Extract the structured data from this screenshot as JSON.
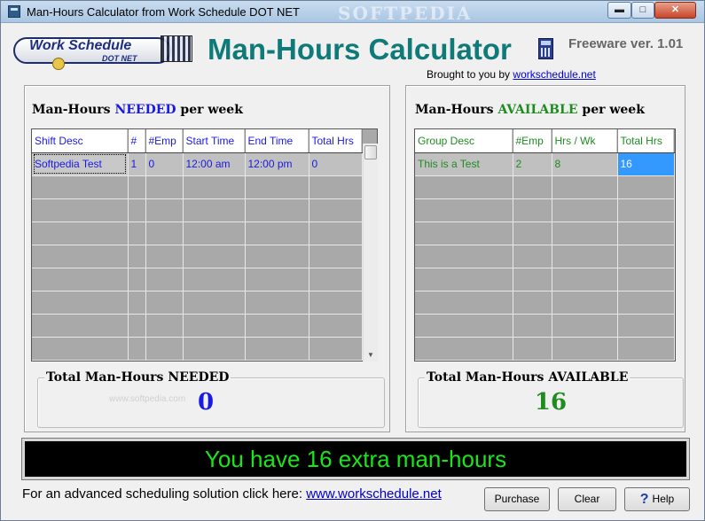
{
  "window": {
    "title": "Man-Hours Calculator from Work Schedule DOT NET",
    "watermark": "SOFTPEDIA"
  },
  "header": {
    "logo_text": "Work Schedule",
    "logo_sub": "DOT NET",
    "app_title": "Man-Hours Calculator",
    "brought_prefix": "Brought to you by",
    "brought_link": "workschedule.net",
    "version": "Freeware ver. 1.01"
  },
  "needed": {
    "heading_pre": "Man-Hours",
    "heading_hl": "NEEDED",
    "heading_post": "per week",
    "columns": [
      "Shift Desc",
      "#",
      "#Emp",
      "Start Time",
      "End Time",
      "Total Hrs"
    ],
    "rows": [
      [
        "Softpedia Test",
        "1",
        "0",
        "12:00 am",
        "12:00 pm",
        "0"
      ]
    ],
    "total_label": "Total Man-Hours NEEDED",
    "total_value": "0",
    "watermark": "www.softpedia.com"
  },
  "available": {
    "heading_pre": "Man-Hours",
    "heading_hl": "AVAILABLE",
    "heading_post": "per week",
    "columns": [
      "Group Desc",
      "#Emp",
      "Hrs / Wk",
      "Total Hrs"
    ],
    "rows": [
      [
        "This is a Test",
        "2",
        "8",
        "16"
      ]
    ],
    "total_label": "Total Man-Hours AVAILABLE",
    "total_value": "16"
  },
  "status": {
    "message": "You have 16 extra man-hours"
  },
  "footer": {
    "prompt": "For an advanced scheduling solution click here:",
    "link": "www.workschedule.net"
  },
  "buttons": {
    "purchase": "Purchase",
    "clear": "Clear",
    "help": "Help"
  },
  "colors": {
    "title_teal": "#0f7a78",
    "needed_blue": "#1a1ae6",
    "available_green": "#1f8c1f",
    "status_green": "#19e619"
  }
}
